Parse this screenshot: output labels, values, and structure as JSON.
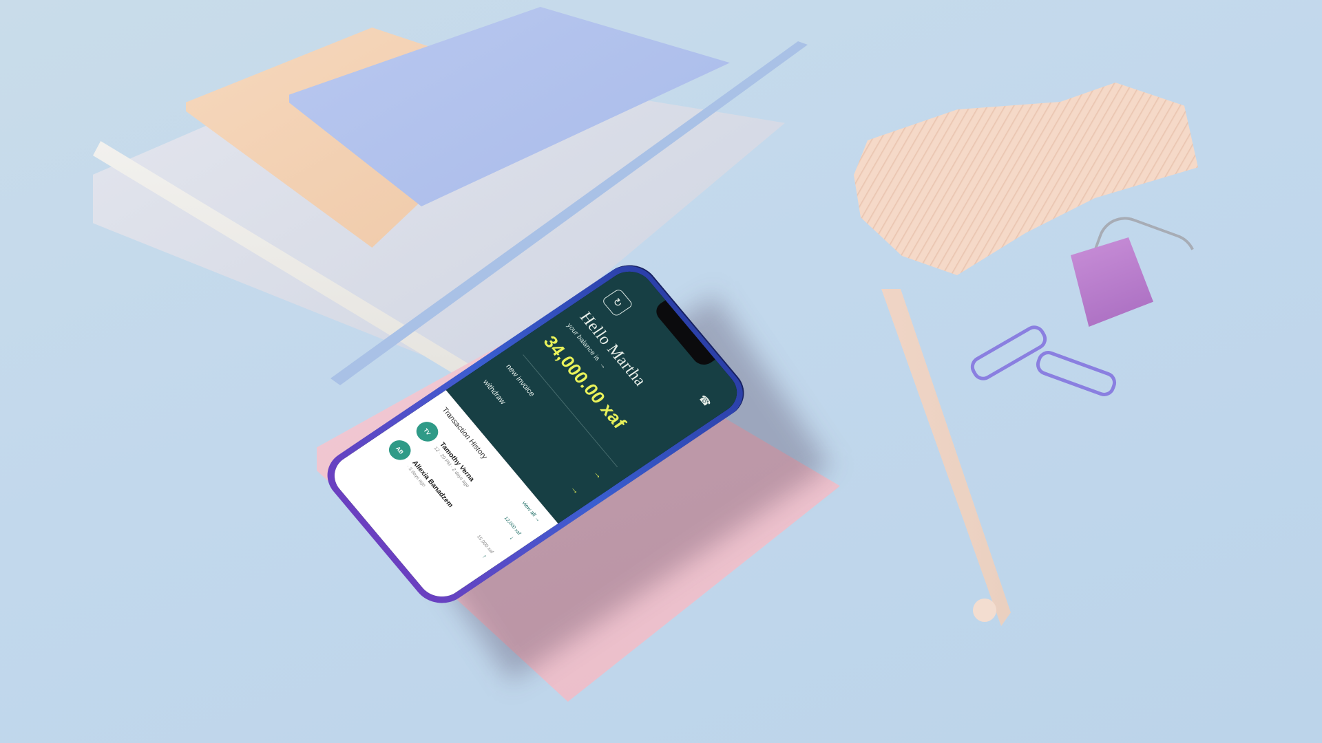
{
  "app": {
    "greeting": "Hello Martha",
    "balance_caption": "your balance is",
    "balance_amount": "34,000.00 xaf",
    "actions": [
      {
        "label": "new invoice"
      },
      {
        "label": "withdraw"
      }
    ],
    "transactions": {
      "title": "Transaction History",
      "view_all_label": "view all",
      "items": [
        {
          "initials": "TV",
          "name": "Tamothy Verna",
          "meta": "12 · 20 PM · 2 days ago",
          "amount": "12,000 xaf",
          "direction_icon": "arrow-down-icon"
        },
        {
          "initials": "AB",
          "name": "Allexia Banadzem",
          "meta": "· 3 days ago",
          "amount": "15,000 xaf",
          "direction_icon": "arrow-up-icon"
        }
      ]
    }
  },
  "icons": {
    "refresh": "refresh-icon",
    "bell": "bell-icon",
    "arrow_right": "arrow-right-icon"
  },
  "colors": {
    "app_header_bg": "#173f44",
    "accent_yellow": "#e9f25a",
    "avatar_green": "#2f9a87",
    "desk_background": "#c2d8ec"
  }
}
